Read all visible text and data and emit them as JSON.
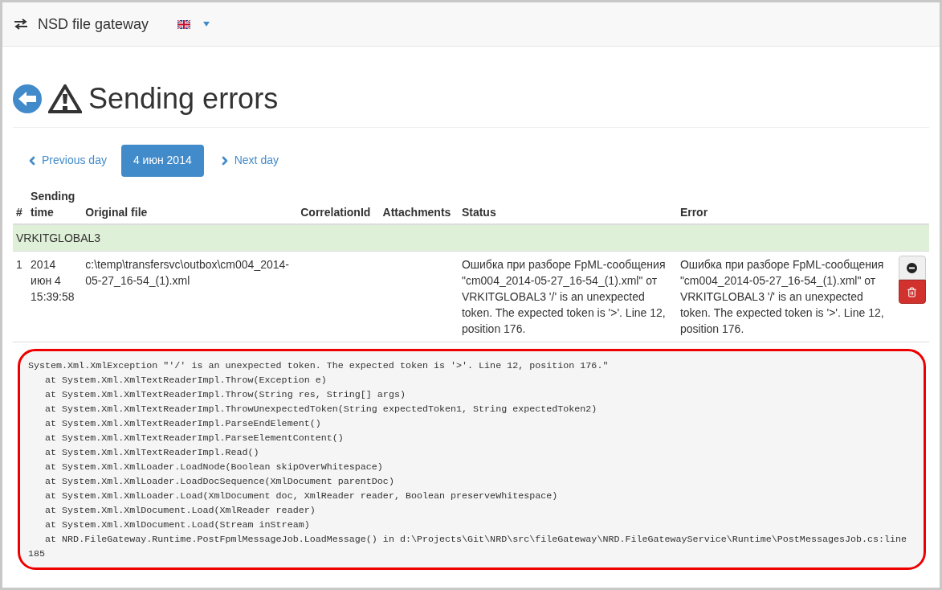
{
  "navbar": {
    "brand": "NSD file gateway"
  },
  "page": {
    "title": "Sending errors"
  },
  "pager": {
    "previous": "Previous day",
    "current": "4 июн 2014",
    "next": "Next day"
  },
  "table": {
    "columns": [
      "#",
      "Sending time",
      "Original file",
      "CorrelationId",
      "Attachments",
      "Status",
      "Error"
    ],
    "groups": [
      {
        "name": "VRKITGLOBAL3",
        "rows": [
          {
            "number": "1",
            "time": "2014 июн 4 15:39:58",
            "file": "c:\\temp\\transfersvc\\outbox\\cm004_2014-05-27_16-54_(1).xml",
            "status": "Ошибка при разборе FpML-сообщения \"cm004_2014-05-27_16-54_(1).xml\" от VRKITGLOBAL3 '/' is an unexpected token. The expected token is '>'. Line 12, position 176.",
            "error": "Ошибка при разборе FpML-сообщения \"cm004_2014-05-27_16-54_(1).xml\" от VRKITGLOBAL3 '/' is an unexpected token. The expected token is '>'. Line 12, position 176."
          }
        ]
      }
    ]
  },
  "stack_trace": {
    "lines": [
      "System.Xml.XmlException \"'/' is an unexpected token. The expected token is '>'. Line 12, position 176.\"",
      "   at System.Xml.XmlTextReaderImpl.Throw(Exception e)",
      "   at System.Xml.XmlTextReaderImpl.Throw(String res, String[] args)",
      "   at System.Xml.XmlTextReaderImpl.ThrowUnexpectedToken(String expectedToken1, String expectedToken2)",
      "   at System.Xml.XmlTextReaderImpl.ParseEndElement()",
      "   at System.Xml.XmlTextReaderImpl.ParseElementContent()",
      "   at System.Xml.XmlTextReaderImpl.Read()",
      "   at System.Xml.XmlLoader.LoadNode(Boolean skipOverWhitespace)",
      "   at System.Xml.XmlLoader.LoadDocSequence(XmlDocument parentDoc)",
      "   at System.Xml.XmlLoader.Load(XmlDocument doc, XmlReader reader, Boolean preserveWhitespace)",
      "   at System.Xml.XmlDocument.Load(XmlReader reader)",
      "   at System.Xml.XmlDocument.Load(Stream inStream)",
      "   at NRD.FileGateway.Runtime.PostFpmlMessageJob.LoadMessage() in d:\\Projects\\Git\\NRD\\src\\fileGateway\\NRD.FileGatewayService\\Runtime\\PostMessagesJob.cs:line 185"
    ]
  }
}
